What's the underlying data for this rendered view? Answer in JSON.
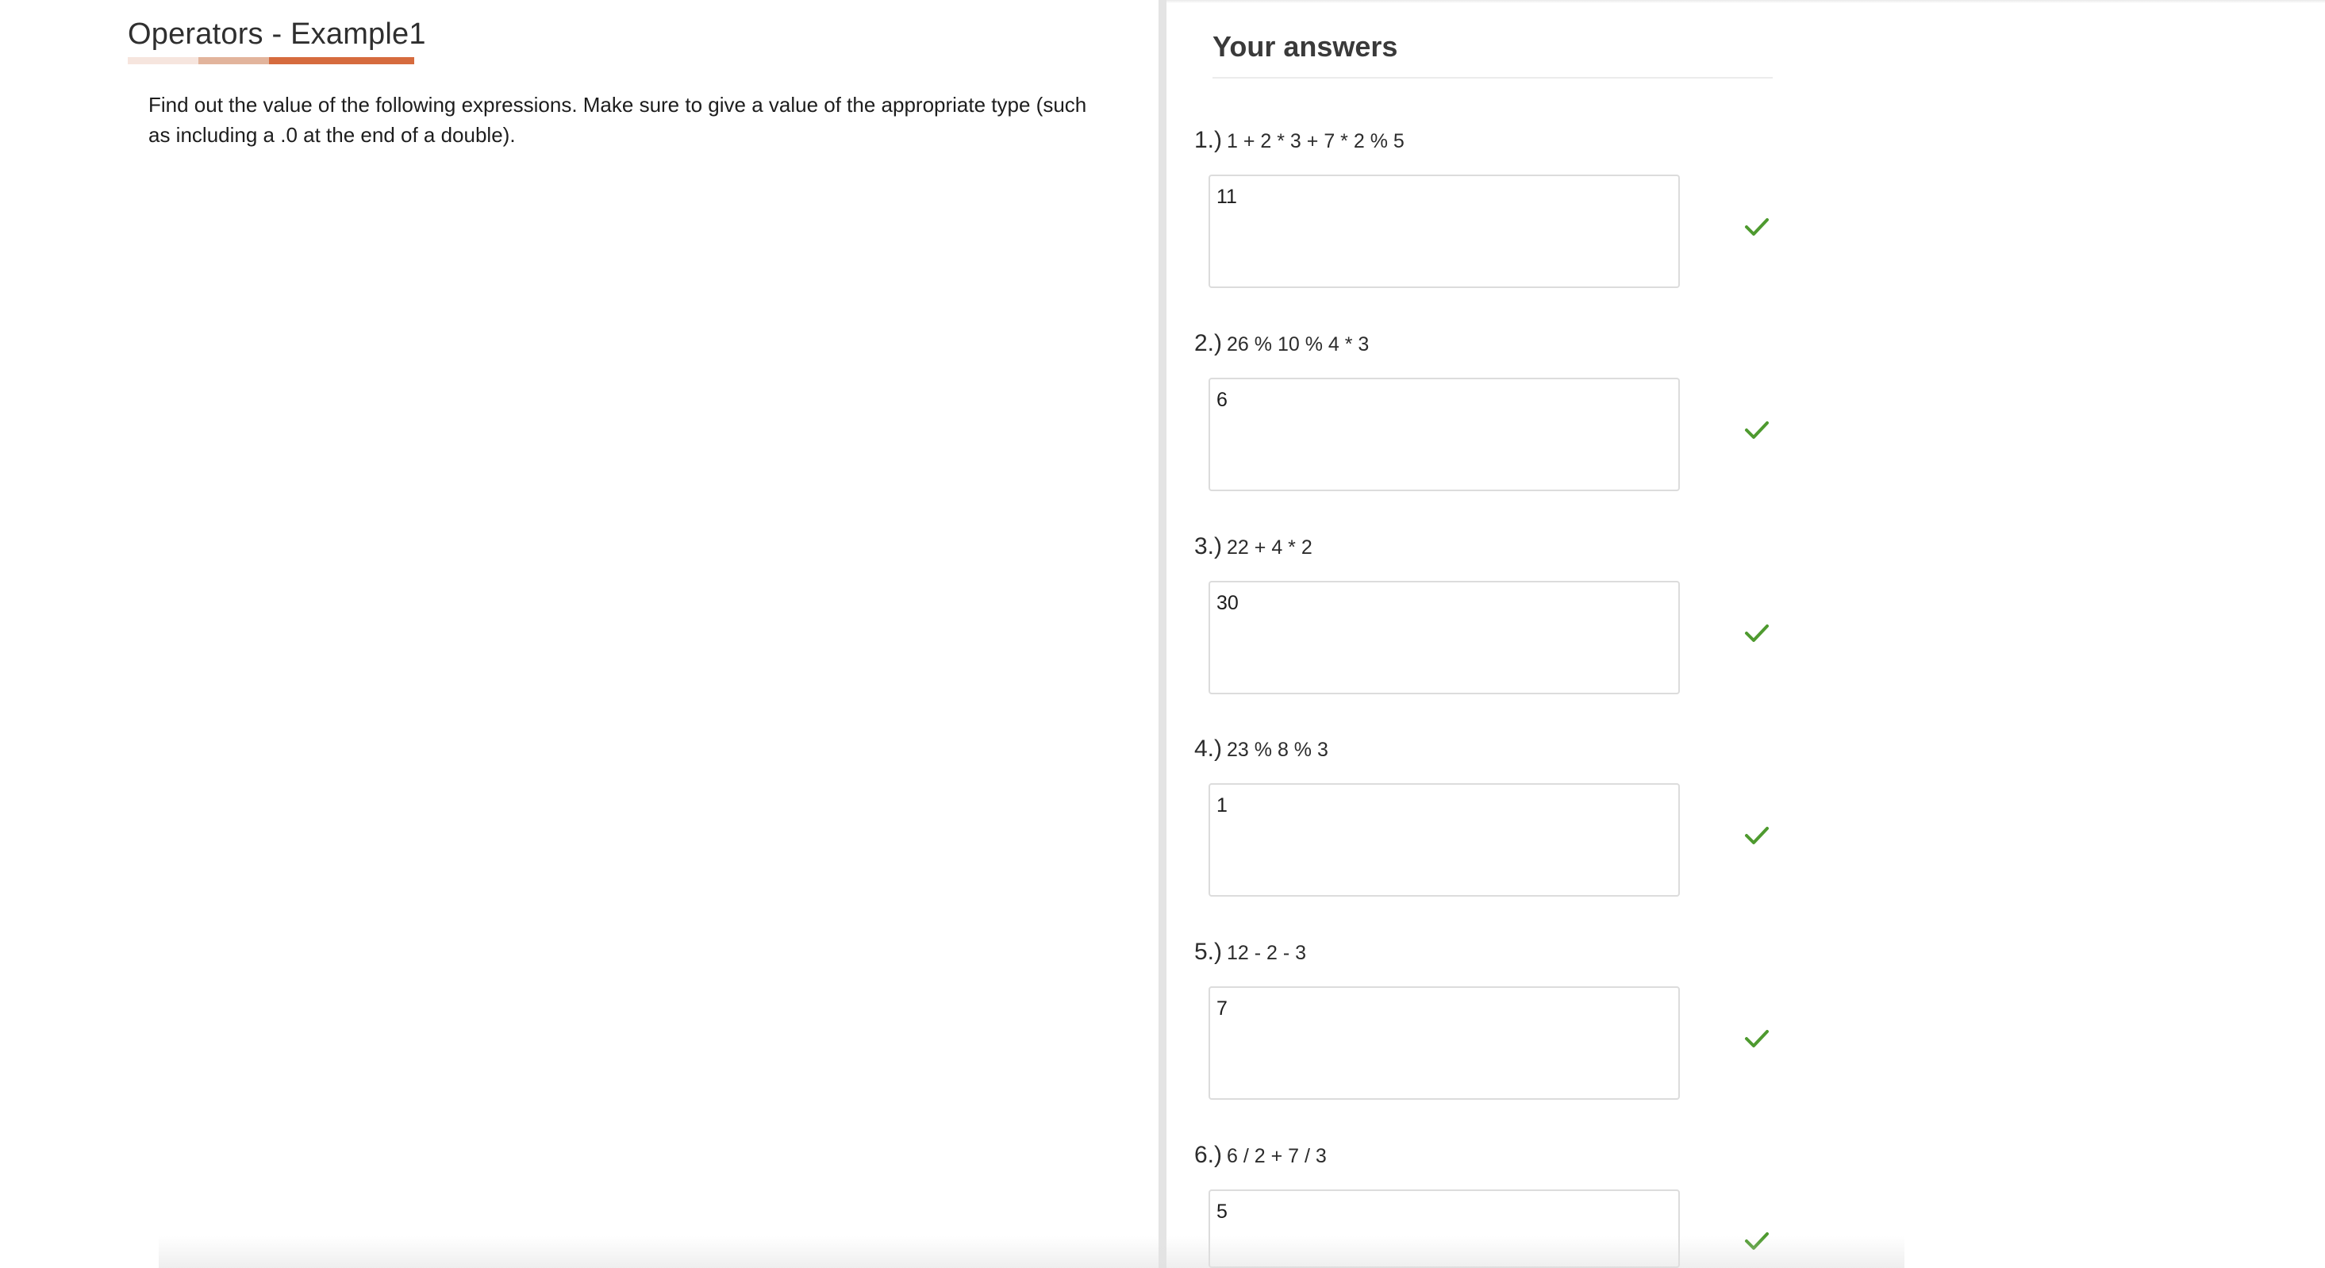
{
  "left": {
    "title": "Operators - Example1",
    "instructions": "Find out the value of the following expressions. Make sure to give a value of the appropriate type (such as including a .0 at the end of a double).",
    "underline_colors": [
      "#f6e5de",
      "#e2b49c",
      "#d66b3e"
    ]
  },
  "right": {
    "title": "Your answers",
    "questions": [
      {
        "number": "1.)",
        "expression": "1 + 2 * 3 + 7 * 2 % 5",
        "answer": "11",
        "status": "correct"
      },
      {
        "number": "2.)",
        "expression": "26 % 10 % 4 * 3",
        "answer": "6",
        "status": "correct"
      },
      {
        "number": "3.)",
        "expression": "22 + 4 * 2",
        "answer": "30",
        "status": "correct"
      },
      {
        "number": "4.)",
        "expression": "23 % 8 % 3",
        "answer": "1",
        "status": "correct"
      },
      {
        "number": "5.)",
        "expression": "12 - 2 - 3",
        "answer": "7",
        "status": "correct"
      },
      {
        "number": "6.)",
        "expression": "6 / 2 + 7 / 3",
        "answer": "5",
        "status": "correct"
      }
    ],
    "check_icon": "check-icon",
    "check_color": "#4e9a2f"
  }
}
